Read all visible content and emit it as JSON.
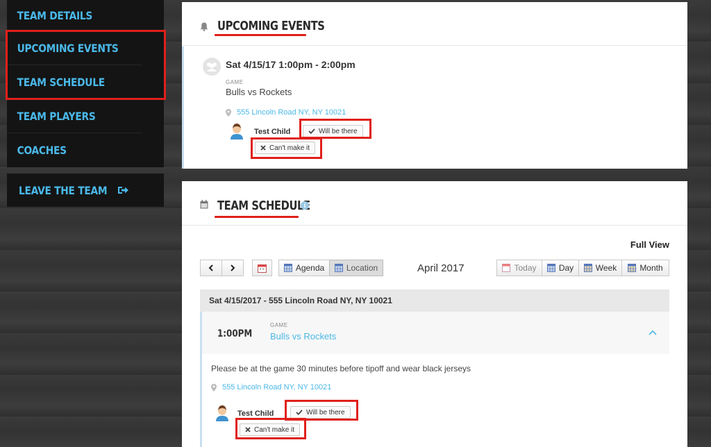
{
  "sidebar": {
    "items": [
      {
        "label": "TEAM DETAILS"
      },
      {
        "label": "UPCOMING EVENTS"
      },
      {
        "label": "TEAM SCHEDULE"
      },
      {
        "label": "TEAM PLAYERS"
      },
      {
        "label": "COACHES"
      }
    ],
    "leave_label": "LEAVE THE TEAM",
    "leave_icon": "sign-out-icon"
  },
  "upcoming": {
    "title": "UPCOMING EVENTS",
    "icon": "bell-icon",
    "event": {
      "datetime": "Sat 4/15/17 1:00pm - 2:00pm",
      "type": "GAME",
      "name": "Bulls vs Rockets",
      "location": "555 Lincoln Road NY, NY 10021",
      "child": "Test Child",
      "yes_label": "Will be there",
      "no_label": "Can't make it"
    }
  },
  "schedule": {
    "title": "TEAM SCHEDULE",
    "full_view_label": "Full View",
    "view_agenda": "Agenda",
    "view_location": "Location",
    "month_label": "April 2017",
    "today_label": "Today",
    "day_label": "Day",
    "week_label": "Week",
    "month_btn_label": "Month",
    "date_row": "Sat 4/15/2017 - 555 Lincoln Road NY, NY 10021",
    "event": {
      "time": "1:00PM",
      "type": "GAME",
      "name": "Bulls vs Rockets",
      "description": "Please be at the game 30 minutes before tipoff and wear black jerseys",
      "location": "555 Lincoln Road NY, NY 10021",
      "child": "Test Child",
      "yes_label": "Will be there",
      "no_label": "Can't make it"
    }
  },
  "colors": {
    "accent": "#4ab8e8",
    "highlight": "#e0201b",
    "sidebar_bg": "#141414"
  }
}
